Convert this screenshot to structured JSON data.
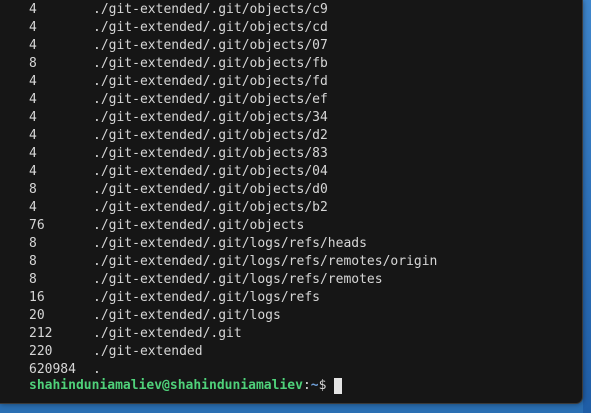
{
  "terminal": {
    "lines": [
      {
        "size": "4",
        "path": "./git-extended/.git/objects/c9"
      },
      {
        "size": "4",
        "path": "./git-extended/.git/objects/cd"
      },
      {
        "size": "4",
        "path": "./git-extended/.git/objects/07"
      },
      {
        "size": "8",
        "path": "./git-extended/.git/objects/fb"
      },
      {
        "size": "4",
        "path": "./git-extended/.git/objects/fd"
      },
      {
        "size": "4",
        "path": "./git-extended/.git/objects/ef"
      },
      {
        "size": "4",
        "path": "./git-extended/.git/objects/34"
      },
      {
        "size": "4",
        "path": "./git-extended/.git/objects/d2"
      },
      {
        "size": "4",
        "path": "./git-extended/.git/objects/83"
      },
      {
        "size": "4",
        "path": "./git-extended/.git/objects/04"
      },
      {
        "size": "8",
        "path": "./git-extended/.git/objects/d0"
      },
      {
        "size": "4",
        "path": "./git-extended/.git/objects/b2"
      },
      {
        "size": "76",
        "path": "./git-extended/.git/objects"
      },
      {
        "size": "8",
        "path": "./git-extended/.git/logs/refs/heads"
      },
      {
        "size": "8",
        "path": "./git-extended/.git/logs/refs/remotes/origin"
      },
      {
        "size": "8",
        "path": "./git-extended/.git/logs/refs/remotes"
      },
      {
        "size": "16",
        "path": "./git-extended/.git/logs/refs"
      },
      {
        "size": "20",
        "path": "./git-extended/.git/logs"
      },
      {
        "size": "212",
        "path": "./git-extended/.git"
      },
      {
        "size": "220",
        "path": "./git-extended"
      },
      {
        "size": "620984",
        "path": "."
      }
    ],
    "prompt": {
      "user_host": "shahinduniamaliev@shahinduniamaliev",
      "separator": ":",
      "cwd": "~",
      "symbol": "$"
    }
  }
}
